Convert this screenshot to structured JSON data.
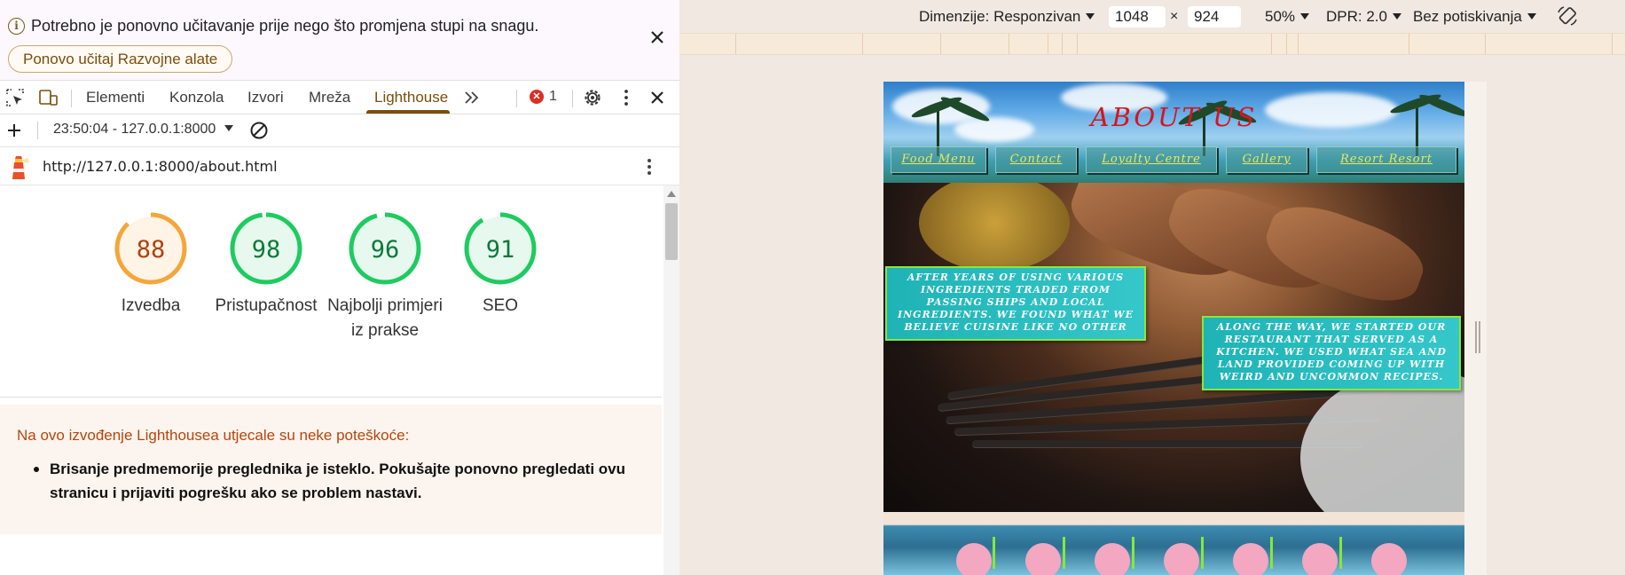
{
  "devtools": {
    "notice": {
      "message": "Potrebno je ponovno učitavanje prije nego što promjena stupi na snagu.",
      "reload_button": "Ponovo učitaj Razvojne alate"
    },
    "tabs": [
      {
        "label": "Elementi"
      },
      {
        "label": "Konzola"
      },
      {
        "label": "Izvori"
      },
      {
        "label": "Mreža"
      },
      {
        "label": "Lighthouse"
      }
    ],
    "active_tab": "Lighthouse",
    "error_count": "1",
    "run_select": "23:50:04 - 127.0.0.1:8000",
    "url": "http://127.0.0.1:8000/about.html",
    "scores": [
      {
        "value": 88,
        "label": "Izvedba",
        "color": "#f4a63a",
        "text_color": "#b0410d",
        "fill": "#fff4e6"
      },
      {
        "value": 98,
        "label": "Pristupačnost",
        "color": "#1ecb60",
        "text_color": "#0b7a3a",
        "fill": "#e7f8ee"
      },
      {
        "value": 96,
        "label": "Najbolji primjeri iz prakse",
        "color": "#1ecb60",
        "text_color": "#0b7a3a",
        "fill": "#e7f8ee"
      },
      {
        "value": 91,
        "label": "SEO",
        "color": "#1ecb60",
        "text_color": "#0b7a3a",
        "fill": "#e7f8ee"
      }
    ],
    "warning": {
      "title": "Na ovo izvođenje Lighthousea utjecale su neke poteškoće:",
      "item": "Brisanje predmemorije preglednika je isteklo. Pokušajte ponovno pregledati ovu stranicu i prijaviti pogrešku ako se problem nastavi."
    }
  },
  "emulation": {
    "dimensions_label": "Dimenzije: Responzivan",
    "width": "1048",
    "times": "×",
    "height": "924",
    "zoom": "50%",
    "dpr": "DPR: 2.0",
    "throttling": "Bez potiskivanja"
  },
  "website": {
    "title": "ABOUT US",
    "nav": [
      "Food Menu",
      "Contact",
      "Loyalty Centre",
      "Gallery",
      "Resort Resort"
    ],
    "callout_left": "AFTER YEARS OF USING VARIOUS INGREDIENTS TRADED FROM PASSING SHIPS AND LOCAL INGREDIENTS. WE FOUND WHAT WE BELIEVE CUISINE LIKE NO OTHER",
    "callout_right": "ALONG THE WAY, WE STARTED OUR RESTAURANT THAT SERVED AS A KITCHEN. WE USED WHAT SEA AND LAND PROVIDED COMING UP WITH WEIRD AND UNCOMMON RECIPES."
  },
  "colors": {
    "accent": "#7a4e0c",
    "good": "#1ecb60",
    "average": "#f4a63a",
    "error": "#d93025"
  }
}
